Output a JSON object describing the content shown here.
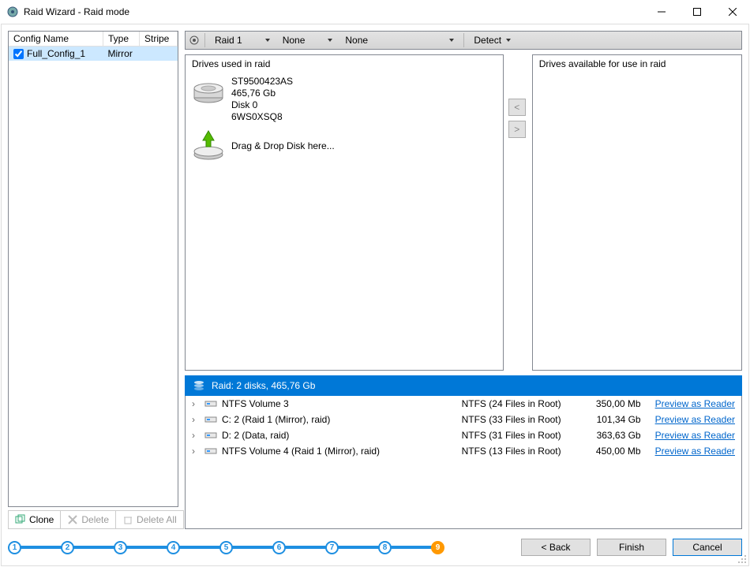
{
  "window": {
    "title": "Raid Wizard - Raid mode"
  },
  "leftpane": {
    "headers": [
      "Config Name",
      "Type",
      "Stripe"
    ],
    "rows": [
      {
        "checked": true,
        "name": "Full_Config_1",
        "type": "Mirror",
        "stripe": ""
      }
    ],
    "buttons": {
      "clone": "Clone",
      "delete": "Delete",
      "deleteAll": "Delete All"
    }
  },
  "toolbar": {
    "raid": "Raid 1",
    "dd1": "None",
    "dd2": "None",
    "detect": "Detect"
  },
  "drives_used_header": "Drives used in raid",
  "drives_avail_header": "Drives available for use in raid",
  "drive0": {
    "l1": "ST9500423AS",
    "l2": "465,76 Gb",
    "l3": "Disk 0",
    "l4": "6WS0XSQ8"
  },
  "drop_hint": "Drag & Drop Disk here...",
  "arrows": {
    "left": "<",
    "right": ">"
  },
  "raidbar": "Raid: 2 disks, 465,76 Gb",
  "raidlist": [
    {
      "name": "NTFS Volume 3",
      "fs": "NTFS (24 Files in Root)",
      "size": "350,00 Mb",
      "link": "Preview as Reader"
    },
    {
      "name": "C: 2 (Raid 1 (Mirror), raid)",
      "fs": "NTFS (33 Files in Root)",
      "size": "101,34 Gb",
      "link": "Preview as Reader"
    },
    {
      "name": "D: 2 (Data, raid)",
      "fs": "NTFS (31 Files in Root)",
      "size": "363,63 Gb",
      "link": "Preview as Reader"
    },
    {
      "name": "NTFS Volume 4 (Raid 1 (Mirror), raid)",
      "fs": "NTFS (13 Files in Root)",
      "size": "450,00 Mb",
      "link": "Preview as Reader"
    }
  ],
  "footer": {
    "back": "< Back",
    "finish": "Finish",
    "cancel": "Cancel"
  },
  "steps": [
    "1",
    "2",
    "3",
    "4",
    "5",
    "6",
    "7",
    "8",
    "9"
  ]
}
